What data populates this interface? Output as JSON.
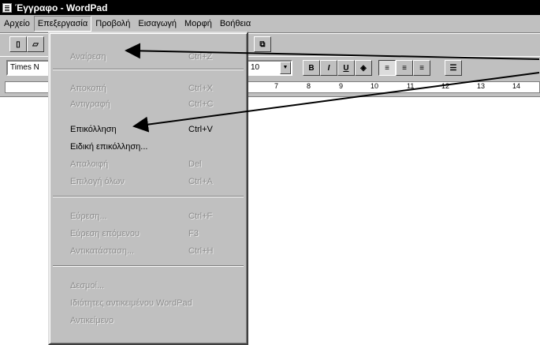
{
  "window": {
    "title": "Έγγραφο - WordPad"
  },
  "menubar": {
    "items": [
      "Αρχείο",
      "Επεξεργασία",
      "Προβολή",
      "Εισαγωγή",
      "Μορφή",
      "Βοήθεια"
    ],
    "active_index": 1
  },
  "toolbar": {
    "font_name": "Times N",
    "font_size": "10"
  },
  "ruler": {
    "marks": [
      "7",
      "8",
      "9",
      "10",
      "11",
      "12",
      "13",
      "14"
    ]
  },
  "edit_menu": {
    "items": [
      {
        "label": "Αναίρεση",
        "shortcut": "Ctrl+Z",
        "enabled": false
      },
      {
        "label": "Αποκοπή",
        "shortcut": "Ctrl+X",
        "enabled": false
      },
      {
        "label": "Αντιγραφή",
        "shortcut": "Ctrl+C",
        "enabled": false
      },
      {
        "label": "Επικόλληση",
        "shortcut": "Ctrl+V",
        "enabled": true
      },
      {
        "label": "Ειδική επικόλληση...",
        "shortcut": "",
        "enabled": true
      },
      {
        "label": "Απαλοιφή",
        "shortcut": "Del",
        "enabled": false
      },
      {
        "label": "Επιλογή όλων",
        "shortcut": "Ctrl+A",
        "enabled": false
      },
      {
        "label": "Εύρεση...",
        "shortcut": "Ctrl+F",
        "enabled": false
      },
      {
        "label": "Εύρεση επόμενου",
        "shortcut": "F3",
        "enabled": false
      },
      {
        "label": "Αντικατάσταση...",
        "shortcut": "Ctrl+H",
        "enabled": false
      },
      {
        "label": "Δεσμοί...",
        "shortcut": "",
        "enabled": false
      },
      {
        "label": "Ιδιότητες αντικειμένου WordPad",
        "shortcut": "",
        "enabled": false
      },
      {
        "label": "Αντικείμενο",
        "shortcut": "",
        "enabled": false
      }
    ]
  }
}
